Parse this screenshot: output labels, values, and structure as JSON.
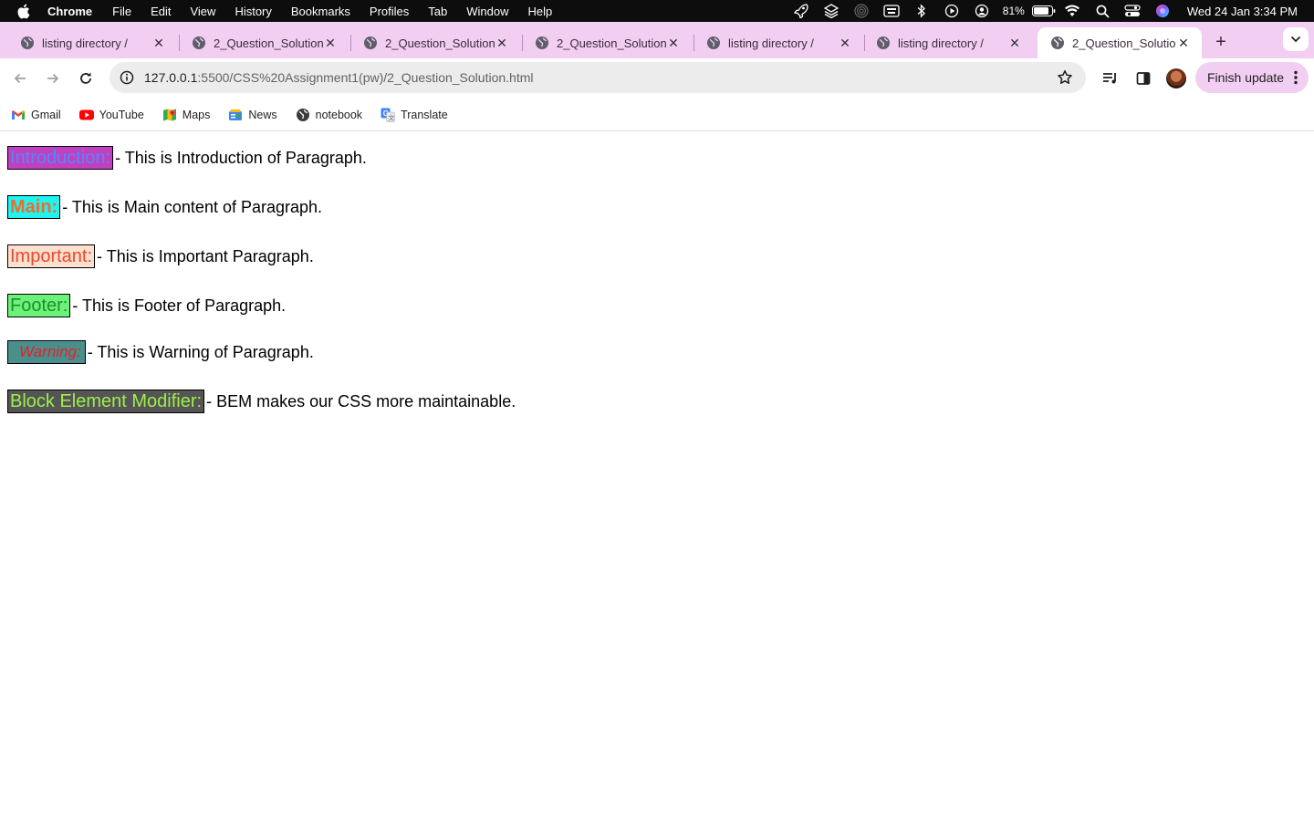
{
  "menubar": {
    "app": "Chrome",
    "items": [
      "File",
      "Edit",
      "View",
      "History",
      "Bookmarks",
      "Profiles",
      "Tab",
      "Window",
      "Help"
    ],
    "battery": "81%",
    "clock": "Wed 24 Jan  3:34 PM"
  },
  "tabs": [
    {
      "title": "listing directory /"
    },
    {
      "title": "2_Question_Solution"
    },
    {
      "title": "2_Question_Solution"
    },
    {
      "title": "2_Question_Solution"
    },
    {
      "title": "listing directory /"
    },
    {
      "title": "listing directory /"
    },
    {
      "title": "2_Question_Solution",
      "active": true
    }
  ],
  "toolbar": {
    "url_host": "127.0.0.1",
    "url_rest": ":5500/CSS%20Assignment1(pw)/2_Question_Solution.html",
    "finish_update": "Finish update"
  },
  "bookmarks": [
    {
      "label": "Gmail",
      "icon": "gmail-icon"
    },
    {
      "label": "YouTube",
      "icon": "youtube-icon"
    },
    {
      "label": "Maps",
      "icon": "maps-icon"
    },
    {
      "label": "News",
      "icon": "news-icon"
    },
    {
      "label": "notebook",
      "icon": "globe-icon"
    },
    {
      "label": "Translate",
      "icon": "translate-icon"
    }
  ],
  "content": {
    "paragraphs": [
      {
        "label": "Introduction:",
        "text": "- This is Introduction of Paragraph."
      },
      {
        "label": "Main:",
        "text": "- This is Main content of Paragraph."
      },
      {
        "label": "Important:",
        "text": "- This is Important Paragraph."
      },
      {
        "label": "Footer:",
        "text": "- This is Footer of Paragraph."
      },
      {
        "label": "Warning:",
        "text": "- This is Warning of Paragraph."
      },
      {
        "label": "Block Element Modifier:",
        "text": "- BEM makes our CSS more maintainable."
      }
    ]
  },
  "colors": {
    "menubar_bg": "#0d0d0d",
    "tabstrip_bg": "#f2cff2",
    "finish_update_bg": "#f2cff2"
  }
}
